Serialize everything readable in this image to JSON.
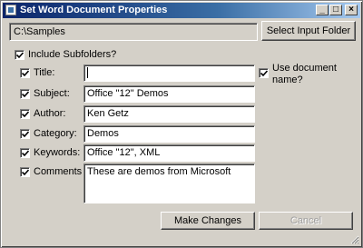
{
  "window": {
    "title": "Set Word Document Properties",
    "min_glyph": "_",
    "max_glyph": "□",
    "close_glyph": "×"
  },
  "input_folder": {
    "path": "C:\\Samples",
    "select_button": "Select Input Folder"
  },
  "include_subfolders": {
    "label": "Include Subfolders?",
    "checked": true
  },
  "use_document_name": {
    "label_line1": "Use document",
    "label_line2": "name?",
    "checked": true
  },
  "fields": {
    "title": {
      "label": "Title:",
      "value": "",
      "checked": true
    },
    "subject": {
      "label": "Subject:",
      "value": "Office \"12\" Demos",
      "checked": true
    },
    "author": {
      "label": "Author:",
      "value": "Ken Getz",
      "checked": true
    },
    "category": {
      "label": "Category:",
      "value": "Demos",
      "checked": true
    },
    "keywords": {
      "label": "Keywords:",
      "value": "Office \"12\", XML",
      "checked": true
    },
    "comments": {
      "label": "Comments",
      "value": "These are demos from Microsoft",
      "checked": true
    }
  },
  "buttons": {
    "make_changes": "Make Changes",
    "cancel": "Cancel"
  }
}
